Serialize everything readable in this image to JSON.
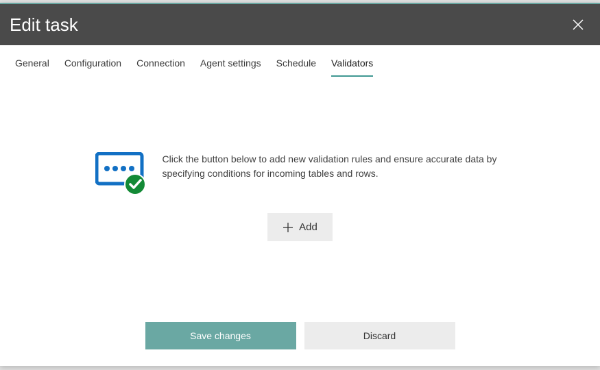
{
  "header": {
    "title": "Edit task"
  },
  "tabs": {
    "items": [
      {
        "label": "General"
      },
      {
        "label": "Configuration"
      },
      {
        "label": "Connection"
      },
      {
        "label": "Agent settings"
      },
      {
        "label": "Schedule"
      },
      {
        "label": "Validators"
      }
    ],
    "active_index": 5
  },
  "validators": {
    "empty_message": "Click the button below to add new validation rules and ensure accurate data by specifying conditions for incoming tables and rows.",
    "add_label": "Add"
  },
  "footer": {
    "save_label": "Save changes",
    "discard_label": "Discard"
  },
  "colors": {
    "accent": "#6aa8a3",
    "header_bg": "#4a4a4a",
    "icon_blue": "#1270c4",
    "icon_green": "#138a36"
  }
}
